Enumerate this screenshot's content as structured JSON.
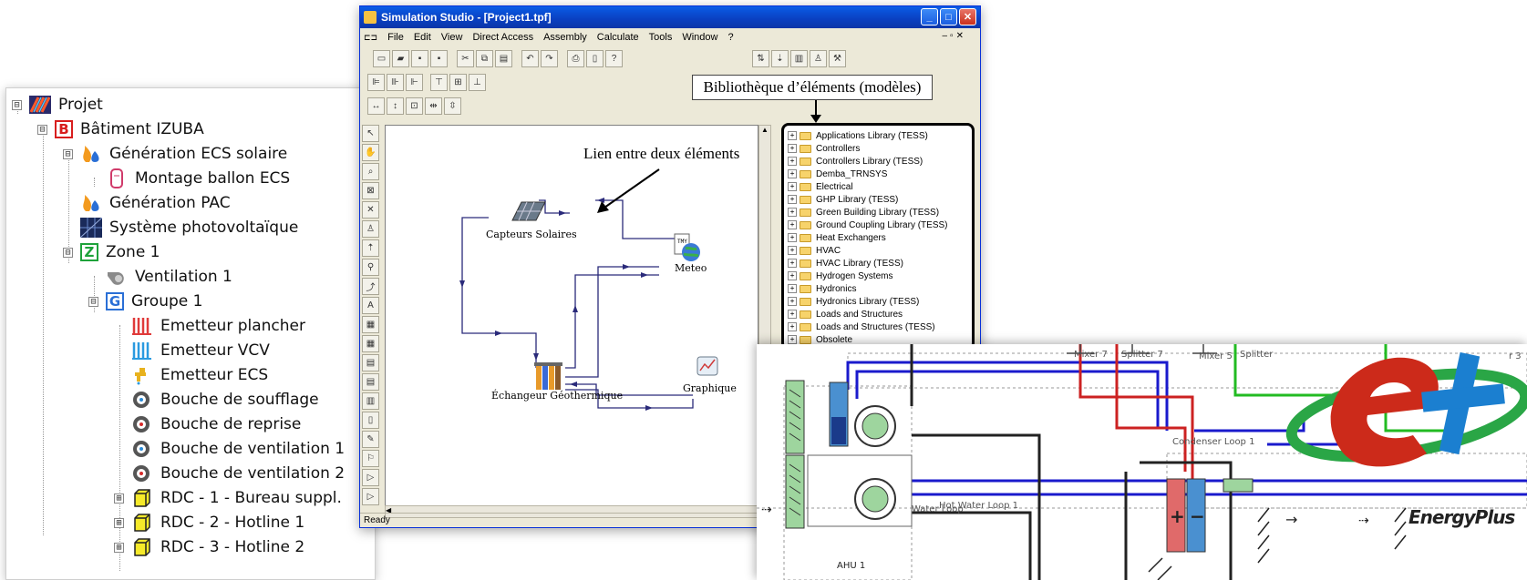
{
  "tree": {
    "items": [
      {
        "label": "Projet",
        "expander": "⊟",
        "icon": "project-icon"
      },
      {
        "label": "Bâtiment IZUBA",
        "expander": "⊟",
        "icon_text": "B",
        "icon": "building-icon"
      },
      {
        "label": "Génération ECS solaire",
        "expander": "⊟",
        "icon": "flame-drop-icon"
      },
      {
        "label": "Montage ballon ECS",
        "expander": "",
        "icon": "tank-icon"
      },
      {
        "label": "Génération PAC",
        "expander": "",
        "icon": "flame-drop-icon"
      },
      {
        "label": "Système photovoltaïque",
        "expander": "",
        "icon": "solar-panel-icon"
      },
      {
        "label": "Zone 1",
        "expander": "⊟",
        "icon_text": "Z",
        "icon": "zone-icon"
      },
      {
        "label": "Ventilation 1",
        "expander": "",
        "icon": "fan-icon"
      },
      {
        "label": "Groupe 1",
        "expander": "⊟",
        "icon_text": "G",
        "icon": "group-icon"
      },
      {
        "label": "Emetteur plancher",
        "expander": "",
        "icon": "floor-emitter-icon"
      },
      {
        "label": "Emetteur VCV",
        "expander": "",
        "icon": "vcv-emitter-icon"
      },
      {
        "label": "Emetteur ECS",
        "expander": "",
        "icon": "tap-icon"
      },
      {
        "label": "Bouche de soufflage",
        "expander": "",
        "icon": "vent-icon"
      },
      {
        "label": "Bouche de reprise",
        "expander": "",
        "icon": "vent-icon"
      },
      {
        "label": "Bouche de ventilation 1",
        "expander": "",
        "icon": "vent-icon"
      },
      {
        "label": "Bouche de ventilation 2",
        "expander": "",
        "icon": "vent-icon"
      },
      {
        "label": "RDC - 1 - Bureau suppl.",
        "expander": "⊞",
        "icon": "room-icon"
      },
      {
        "label": "RDC - 2 - Hotline 1",
        "expander": "⊞",
        "icon": "room-icon"
      },
      {
        "label": "RDC - 3 - Hotline 2",
        "expander": "⊞",
        "icon": "room-icon"
      }
    ]
  },
  "studio": {
    "title": "Simulation Studio - [Project1.tpf]",
    "menu": [
      "File",
      "Edit",
      "View",
      "Direct Access",
      "Assembly",
      "Calculate",
      "Tools",
      "Window",
      "?"
    ],
    "status": "Ready",
    "annotation_library": "Bibliothèque d’éléments (modèles)",
    "annotation_link": "Lien entre deux éléments",
    "components": {
      "solar": "Capteurs Solaires",
      "meteo": "Meteo",
      "exchanger": "Échangeur Géothermique",
      "graph": "Graphique"
    },
    "library": [
      "Applications Library (TESS)",
      "Controllers",
      "Controllers Library (TESS)",
      "Demba_TRNSYS",
      "Electrical",
      "GHP Library (TESS)",
      "Green Building Library (TESS)",
      "Ground Coupling Library (TESS)",
      "Heat Exchangers",
      "HVAC",
      "HVAC Library (TESS)",
      "Hydrogen Systems",
      "Hydronics",
      "Hydronics Library (TESS)",
      "Loads and Structures",
      "Loads and Structures (TESS)",
      "Obsolete"
    ]
  },
  "energyplus": {
    "logo_text": "EnergyPlus",
    "labels": {
      "mixer7": "Mixer 7",
      "splitter7": "Splitter 7",
      "mixer5": "Mixer 5",
      "splitter": "Splitter",
      "r3": "r 3",
      "condenser": "Condenser Loop 1",
      "hotwater": "Hot Water Loop 1",
      "waterloop": "Water Loop",
      "ahu": "AHU 1"
    }
  },
  "colors": {
    "xp_blue": "#0a3fc0",
    "pipe_red": "#cc2222",
    "pipe_blue": "#1a1acc",
    "pipe_green": "#22bb22",
    "logo_red": "#cc2a1a",
    "logo_blue": "#1b7fd0",
    "logo_green": "#2aa646"
  }
}
